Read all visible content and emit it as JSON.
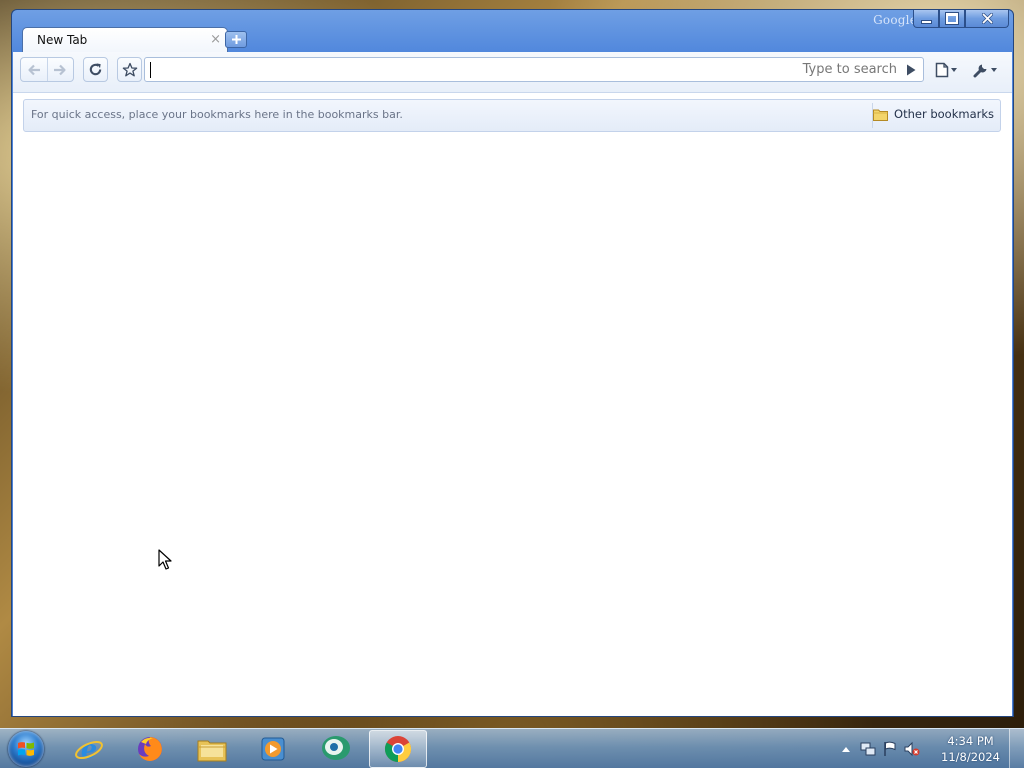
{
  "window": {
    "brand": "Google",
    "controls": {
      "minimize": "minimize",
      "maximize": "maximize",
      "close": "close"
    }
  },
  "tabs": [
    {
      "title": "New Tab",
      "close": "×"
    }
  ],
  "toolbar": {
    "back": "back",
    "forward": "forward",
    "reload": "reload",
    "bookmark_star": "bookmark",
    "omnibox": {
      "value": "",
      "hint": "Type to search"
    },
    "go": "go",
    "page_menu": "page",
    "tools_menu": "tools"
  },
  "bookmarks_bar": {
    "hint": "For quick access, place your bookmarks here in the bookmarks bar.",
    "other_bookmarks": "Other bookmarks"
  },
  "taskbar": {
    "apps": [
      {
        "name": "internet-explorer-icon"
      },
      {
        "name": "firefox-icon"
      },
      {
        "name": "file-explorer-icon"
      },
      {
        "name": "media-player-icon"
      },
      {
        "name": "messenger-icon"
      },
      {
        "name": "chrome-icon",
        "active": true
      }
    ],
    "clock": {
      "time": "4:34 PM",
      "date": "11/8/2024"
    }
  }
}
